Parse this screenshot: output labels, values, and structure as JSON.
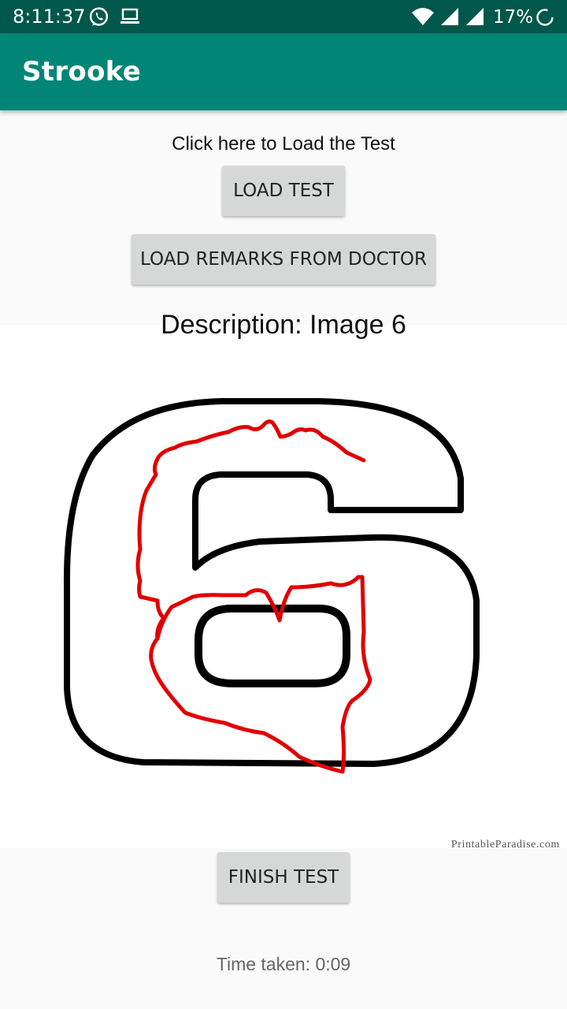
{
  "status_bar": {
    "time": "8:11:37",
    "battery": "17%",
    "icons": [
      "whatsapp-icon",
      "laptop-icon",
      "wifi-icon",
      "signal-icon",
      "signal-icon",
      "battery-saver-icon"
    ]
  },
  "app_bar": {
    "title": "Strooke",
    "color": "#008577",
    "status_color": "#00574b"
  },
  "test": {
    "instruction": "Click here to Load the Test",
    "load_test_label": "LOAD TEST",
    "load_remarks_label": "LOAD REMARKS FROM DOCTOR",
    "description": "Description: Image 6",
    "watermark": "PrintableParadise.com",
    "finish_label": "FINISH TEST",
    "time_taken": "Time taken: 0:09",
    "stroke_color": "#e00000"
  }
}
